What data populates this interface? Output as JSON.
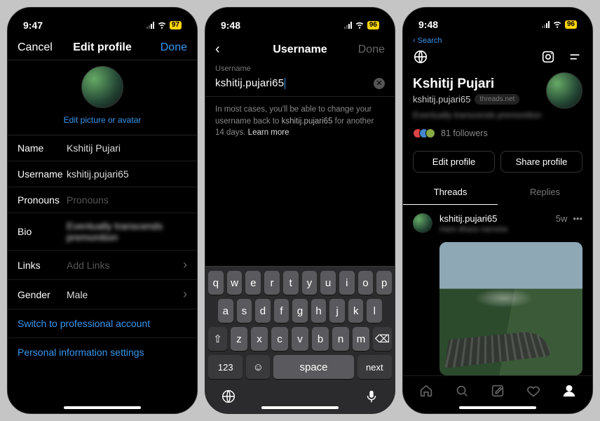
{
  "s1": {
    "time": "9:47",
    "battery": "97",
    "nav": {
      "cancel": "Cancel",
      "title": "Edit profile",
      "done": "Done"
    },
    "avatar_link": "Edit picture or avatar",
    "rows": {
      "name": {
        "label": "Name",
        "value": "Kshitij Pujari"
      },
      "username": {
        "label": "Username",
        "value": "kshitij.pujari65"
      },
      "pronouns": {
        "label": "Pronouns",
        "placeholder": "Pronouns"
      },
      "bio": {
        "label": "Bio",
        "value": "Eventually transcends premonition"
      },
      "links": {
        "label": "Links",
        "placeholder": "Add Links"
      },
      "gender": {
        "label": "Gender",
        "value": "Male"
      }
    },
    "switch_pro": "Switch to professional account",
    "personal_info": "Personal information settings"
  },
  "s2": {
    "time": "9:48",
    "battery": "96",
    "nav": {
      "title": "Username",
      "done": "Done"
    },
    "field_label": "Username",
    "field_value": "kshitij.pujari65",
    "helper_a": "In most cases, you'll be able to change your username back to ",
    "helper_b": "kshitij.pujari65",
    "helper_c": " for another 14 days. ",
    "learn": "Learn more",
    "keys": {
      "r1": [
        "q",
        "w",
        "e",
        "r",
        "t",
        "y",
        "u",
        "i",
        "o",
        "p"
      ],
      "r2": [
        "a",
        "s",
        "d",
        "f",
        "g",
        "h",
        "j",
        "k",
        "l"
      ],
      "r3": [
        "z",
        "x",
        "c",
        "v",
        "b",
        "n",
        "m"
      ],
      "num": "123",
      "space": "space",
      "next": "next"
    }
  },
  "s3": {
    "time": "9:48",
    "battery": "96",
    "back_search": "Search",
    "display_name": "Kshitij Pujari",
    "handle": "kshitij.pujari65",
    "pill": "threads.net",
    "bio": "Eventually transcends premonition",
    "followers": "81 followers",
    "edit_profile": "Edit profile",
    "share_profile": "Share profile",
    "tab_threads": "Threads",
    "tab_replies": "Replies",
    "post": {
      "user": "kshitij.pujari65",
      "age": "5w",
      "text": "Hare dhara namshe"
    }
  }
}
